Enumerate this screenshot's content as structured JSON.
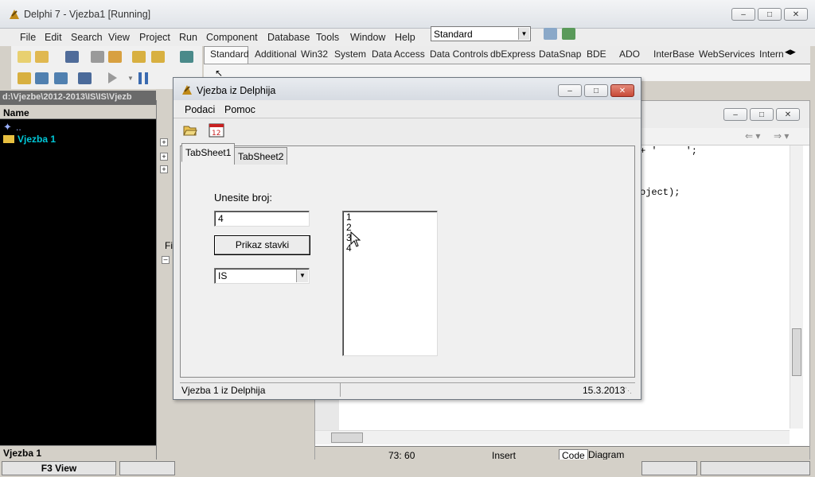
{
  "main_window": {
    "title": "Delphi 7 - Vjezba1 [Running]",
    "menu": [
      "File",
      "Edit",
      "Search",
      "View",
      "Project",
      "Run",
      "Component",
      "Database",
      "Tools",
      "Window",
      "Help"
    ],
    "desktop_combo": "Standard",
    "palette_tabs": [
      "Standard",
      "Additional",
      "Win32",
      "System",
      "Data Access",
      "Data Controls",
      "dbExpress",
      "DataSnap",
      "BDE",
      "ADO",
      "InterBase",
      "WebServices",
      "Intern"
    ]
  },
  "project_manager": {
    "path": "d:\\Vjezbe\\2012-2013\\IS\\IS\\Vjezb",
    "column_header": "Name",
    "root_item": "..",
    "project_item": "Vjezba 1",
    "bottom_label": "Vjezba 1"
  },
  "object_inspector": {
    "partial_label": "Fil"
  },
  "code_editor": {
    "line1": "+ '     ';",
    "line2": "oject);",
    "position": "73:  60",
    "mode": "Insert",
    "tabs": [
      "Code",
      "Diagram"
    ]
  },
  "fkeys": {
    "f3": "F3 View"
  },
  "dialog": {
    "title": "Vjezba iz Delphija",
    "menu": [
      "Podaci",
      "Pomoc"
    ],
    "tabs": [
      "TabSheet1",
      "TabSheet2"
    ],
    "prompt_label": "Unesite broj:",
    "number_input": "4",
    "show_button": "Prikaz stavki",
    "combo_value": "IS",
    "list_items": [
      "1",
      "2",
      "3",
      "4"
    ],
    "status_left": "Vjezba 1 iz Delphija",
    "status_right": "15.3.2013"
  },
  "colors": {
    "tree_bg": "#000000",
    "tree_text": "#00c8d8",
    "code_bg": "#ffffff",
    "window_chrome": "#d4d0c8"
  }
}
